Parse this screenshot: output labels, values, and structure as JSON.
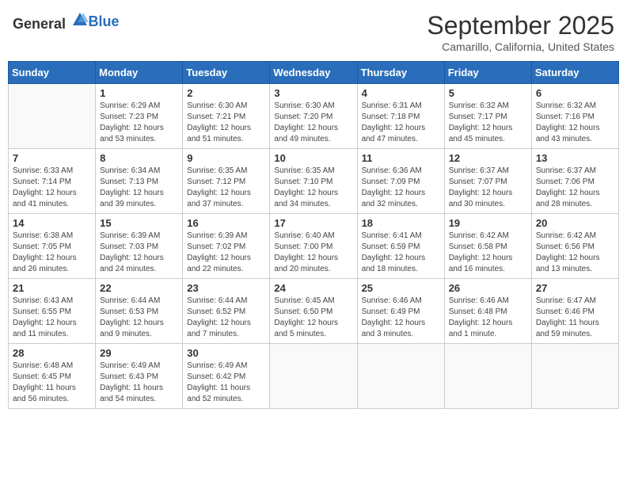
{
  "header": {
    "logo_general": "General",
    "logo_blue": "Blue",
    "month": "September 2025",
    "location": "Camarillo, California, United States"
  },
  "days_of_week": [
    "Sunday",
    "Monday",
    "Tuesday",
    "Wednesday",
    "Thursday",
    "Friday",
    "Saturday"
  ],
  "weeks": [
    [
      {
        "day": "",
        "info": ""
      },
      {
        "day": "1",
        "info": "Sunrise: 6:29 AM\nSunset: 7:23 PM\nDaylight: 12 hours\nand 53 minutes."
      },
      {
        "day": "2",
        "info": "Sunrise: 6:30 AM\nSunset: 7:21 PM\nDaylight: 12 hours\nand 51 minutes."
      },
      {
        "day": "3",
        "info": "Sunrise: 6:30 AM\nSunset: 7:20 PM\nDaylight: 12 hours\nand 49 minutes."
      },
      {
        "day": "4",
        "info": "Sunrise: 6:31 AM\nSunset: 7:18 PM\nDaylight: 12 hours\nand 47 minutes."
      },
      {
        "day": "5",
        "info": "Sunrise: 6:32 AM\nSunset: 7:17 PM\nDaylight: 12 hours\nand 45 minutes."
      },
      {
        "day": "6",
        "info": "Sunrise: 6:32 AM\nSunset: 7:16 PM\nDaylight: 12 hours\nand 43 minutes."
      }
    ],
    [
      {
        "day": "7",
        "info": "Sunrise: 6:33 AM\nSunset: 7:14 PM\nDaylight: 12 hours\nand 41 minutes."
      },
      {
        "day": "8",
        "info": "Sunrise: 6:34 AM\nSunset: 7:13 PM\nDaylight: 12 hours\nand 39 minutes."
      },
      {
        "day": "9",
        "info": "Sunrise: 6:35 AM\nSunset: 7:12 PM\nDaylight: 12 hours\nand 37 minutes."
      },
      {
        "day": "10",
        "info": "Sunrise: 6:35 AM\nSunset: 7:10 PM\nDaylight: 12 hours\nand 34 minutes."
      },
      {
        "day": "11",
        "info": "Sunrise: 6:36 AM\nSunset: 7:09 PM\nDaylight: 12 hours\nand 32 minutes."
      },
      {
        "day": "12",
        "info": "Sunrise: 6:37 AM\nSunset: 7:07 PM\nDaylight: 12 hours\nand 30 minutes."
      },
      {
        "day": "13",
        "info": "Sunrise: 6:37 AM\nSunset: 7:06 PM\nDaylight: 12 hours\nand 28 minutes."
      }
    ],
    [
      {
        "day": "14",
        "info": "Sunrise: 6:38 AM\nSunset: 7:05 PM\nDaylight: 12 hours\nand 26 minutes."
      },
      {
        "day": "15",
        "info": "Sunrise: 6:39 AM\nSunset: 7:03 PM\nDaylight: 12 hours\nand 24 minutes."
      },
      {
        "day": "16",
        "info": "Sunrise: 6:39 AM\nSunset: 7:02 PM\nDaylight: 12 hours\nand 22 minutes."
      },
      {
        "day": "17",
        "info": "Sunrise: 6:40 AM\nSunset: 7:00 PM\nDaylight: 12 hours\nand 20 minutes."
      },
      {
        "day": "18",
        "info": "Sunrise: 6:41 AM\nSunset: 6:59 PM\nDaylight: 12 hours\nand 18 minutes."
      },
      {
        "day": "19",
        "info": "Sunrise: 6:42 AM\nSunset: 6:58 PM\nDaylight: 12 hours\nand 16 minutes."
      },
      {
        "day": "20",
        "info": "Sunrise: 6:42 AM\nSunset: 6:56 PM\nDaylight: 12 hours\nand 13 minutes."
      }
    ],
    [
      {
        "day": "21",
        "info": "Sunrise: 6:43 AM\nSunset: 6:55 PM\nDaylight: 12 hours\nand 11 minutes."
      },
      {
        "day": "22",
        "info": "Sunrise: 6:44 AM\nSunset: 6:53 PM\nDaylight: 12 hours\nand 9 minutes."
      },
      {
        "day": "23",
        "info": "Sunrise: 6:44 AM\nSunset: 6:52 PM\nDaylight: 12 hours\nand 7 minutes."
      },
      {
        "day": "24",
        "info": "Sunrise: 6:45 AM\nSunset: 6:50 PM\nDaylight: 12 hours\nand 5 minutes."
      },
      {
        "day": "25",
        "info": "Sunrise: 6:46 AM\nSunset: 6:49 PM\nDaylight: 12 hours\nand 3 minutes."
      },
      {
        "day": "26",
        "info": "Sunrise: 6:46 AM\nSunset: 6:48 PM\nDaylight: 12 hours\nand 1 minute."
      },
      {
        "day": "27",
        "info": "Sunrise: 6:47 AM\nSunset: 6:46 PM\nDaylight: 11 hours\nand 59 minutes."
      }
    ],
    [
      {
        "day": "28",
        "info": "Sunrise: 6:48 AM\nSunset: 6:45 PM\nDaylight: 11 hours\nand 56 minutes."
      },
      {
        "day": "29",
        "info": "Sunrise: 6:49 AM\nSunset: 6:43 PM\nDaylight: 11 hours\nand 54 minutes."
      },
      {
        "day": "30",
        "info": "Sunrise: 6:49 AM\nSunset: 6:42 PM\nDaylight: 11 hours\nand 52 minutes."
      },
      {
        "day": "",
        "info": ""
      },
      {
        "day": "",
        "info": ""
      },
      {
        "day": "",
        "info": ""
      },
      {
        "day": "",
        "info": ""
      }
    ]
  ]
}
